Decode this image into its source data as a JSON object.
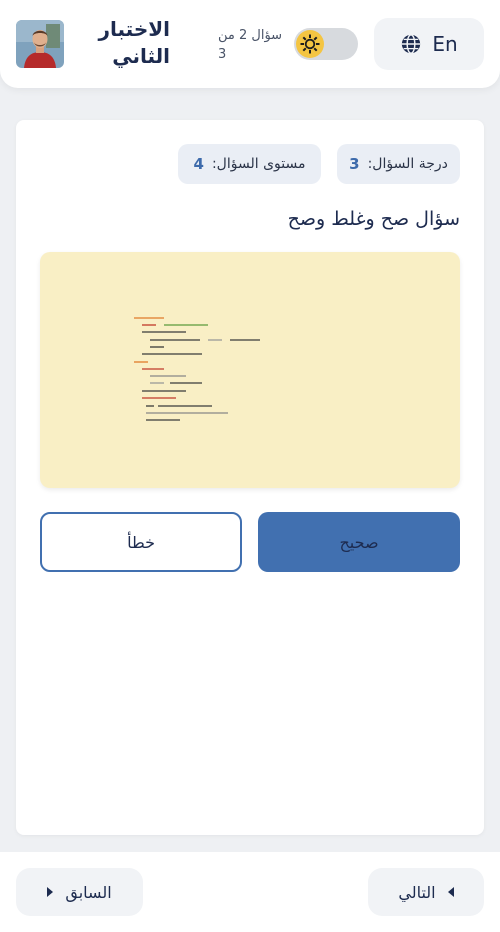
{
  "header": {
    "language_label": "En",
    "progress_text": "سؤال 2 من 3",
    "exam_title": "الاختبار الثاني",
    "theme_mode": "light"
  },
  "question": {
    "grade_label": "درجة السؤال:",
    "grade_value": "3",
    "level_label": "مستوى السؤال:",
    "level_value": "4",
    "text": "سؤال صح وغلط وصح"
  },
  "answers": {
    "true_label": "صحيح",
    "false_label": "خطأ"
  },
  "footer": {
    "next_label": "التالي",
    "prev_label": "السابق"
  },
  "colors": {
    "accent": "#4170b0",
    "image_bg": "#f9efc5",
    "toggle_knob": "#f4c542"
  },
  "icons": {
    "language": "globe-icon",
    "theme": "sun-icon",
    "next": "triangle-left-icon",
    "prev": "triangle-right-icon"
  }
}
